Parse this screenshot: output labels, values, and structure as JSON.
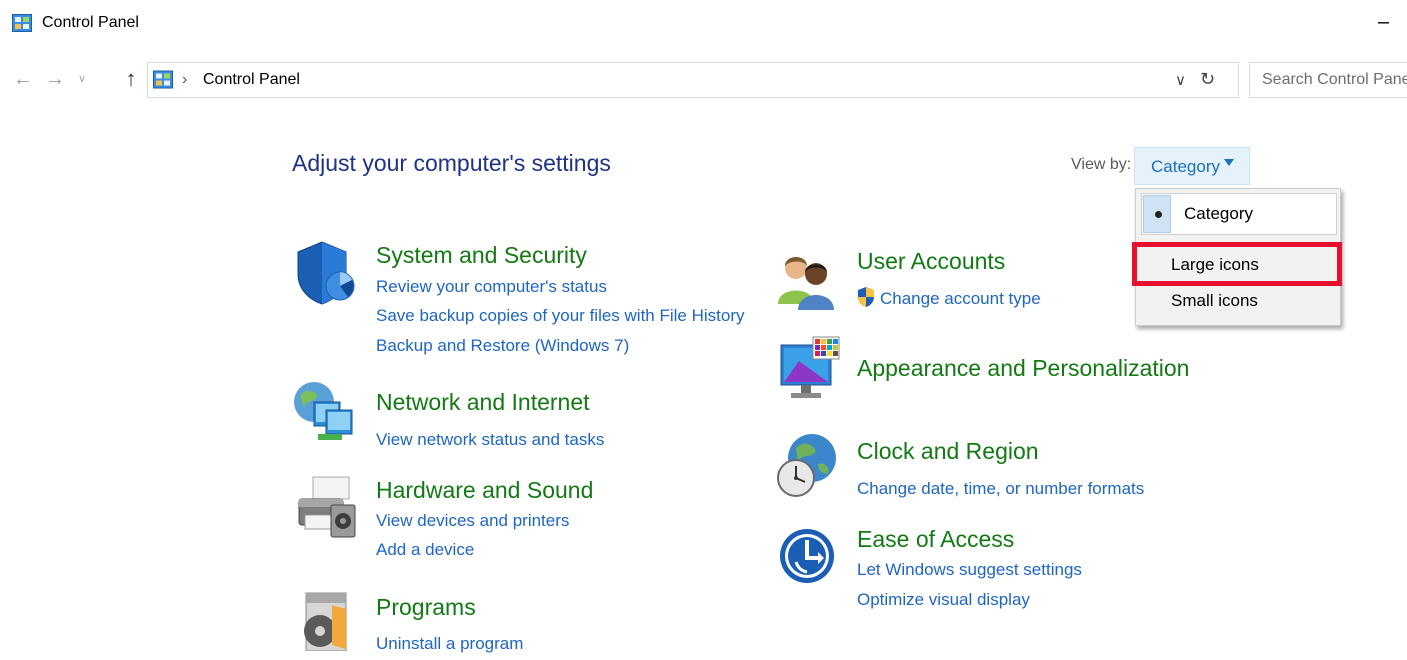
{
  "window": {
    "title": "Control Panel",
    "minimize_glyph": "–"
  },
  "nav": {
    "back_glyph": "←",
    "forward_glyph": "→",
    "recent_glyph": "∨",
    "up_glyph": "↑"
  },
  "address": {
    "separator": "›",
    "path": "Control Panel",
    "dropdown_glyph": "∨",
    "refresh_glyph": "↻"
  },
  "search": {
    "placeholder": "Search Control Panel"
  },
  "page": {
    "title": "Adjust your computer's settings"
  },
  "view_by": {
    "label": "View by:",
    "value": "Category",
    "options": [
      "Category",
      "Large icons",
      "Small icons"
    ],
    "highlighted_option": "Large icons"
  },
  "categories_left": [
    {
      "title": "System and Security",
      "icon": "shield-icon",
      "links": [
        "Review your computer's status",
        "Save backup copies of your files with File History",
        "Backup and Restore (Windows 7)"
      ]
    },
    {
      "title": "Network and Internet",
      "icon": "network-globe-icon",
      "links": [
        "View network status and tasks"
      ]
    },
    {
      "title": "Hardware and Sound",
      "icon": "printer-speaker-icon",
      "links": [
        "View devices and printers",
        "Add a device"
      ]
    },
    {
      "title": "Programs",
      "icon": "programs-disc-icon",
      "links": [
        "Uninstall a program"
      ]
    }
  ],
  "categories_right": [
    {
      "title": "User Accounts",
      "icon": "users-icon",
      "links": [
        "Change account type"
      ]
    },
    {
      "title": "Appearance and Personalization",
      "icon": "monitor-palette-icon",
      "links": []
    },
    {
      "title": "Clock and Region",
      "icon": "clock-globe-icon",
      "links": [
        "Change date, time, or number formats"
      ]
    },
    {
      "title": "Ease of Access",
      "icon": "ease-of-access-icon",
      "links": [
        "Let Windows suggest settings",
        "Optimize visual display"
      ]
    }
  ],
  "colors": {
    "category_title": "#127a12",
    "link": "#1d66c2",
    "page_title": "#1e3287",
    "highlight_border": "#e8112d"
  }
}
